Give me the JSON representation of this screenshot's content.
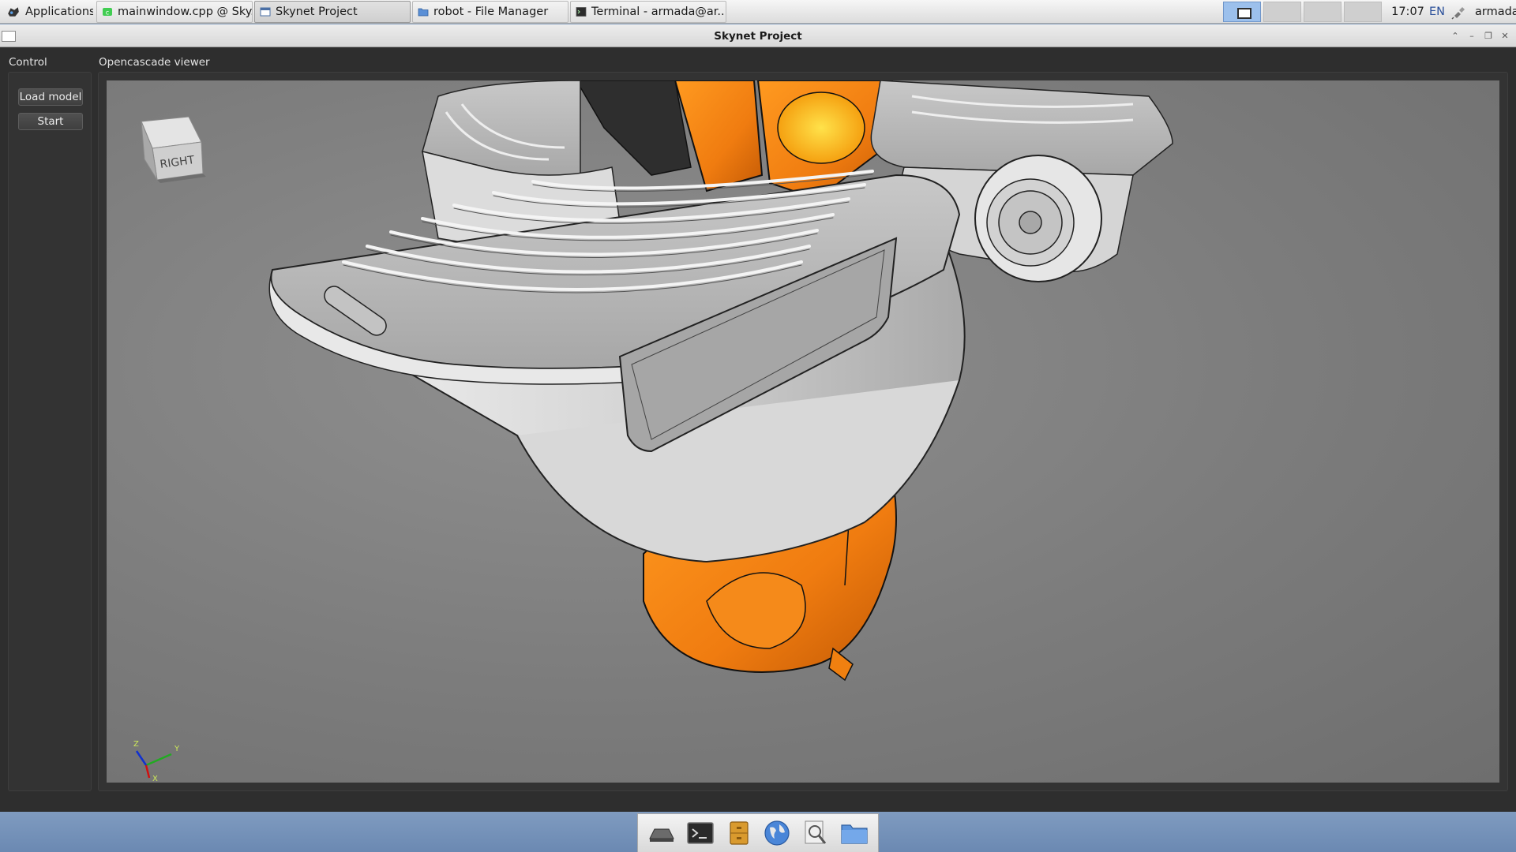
{
  "taskbar": {
    "applications_label": "Applications",
    "tasks": [
      {
        "label": "mainwindow.cpp @ Sky...",
        "icon": "qtcreator-icon"
      },
      {
        "label": "Skynet Project",
        "icon": "window-icon"
      },
      {
        "label": "robot - File Manager",
        "icon": "folder-icon"
      },
      {
        "label": "Terminal - armada@ar...",
        "icon": "terminal-icon"
      }
    ],
    "clock": "17:07",
    "keyboard_layout": "EN",
    "user": "armada"
  },
  "window": {
    "title": "Skynet Project"
  },
  "control_panel": {
    "title": "Control",
    "load_model_label": "Load model",
    "start_label": "Start"
  },
  "viewer": {
    "title": "Opencascade viewer",
    "view_cube_face": "RIGHT",
    "axis_labels": {
      "x": "X",
      "y": "Y",
      "z": "Z"
    }
  },
  "dock": {
    "items": [
      "show-desktop-icon",
      "terminal-icon",
      "file-cabinet-icon",
      "web-browser-icon",
      "app-finder-icon",
      "home-folder-icon"
    ]
  },
  "colors": {
    "robot_orange": "#f07c10",
    "metal_gray": "#b9b9b9",
    "viewport_bg": "#7a7a7a",
    "accent_blue": "#9cc0ec"
  }
}
